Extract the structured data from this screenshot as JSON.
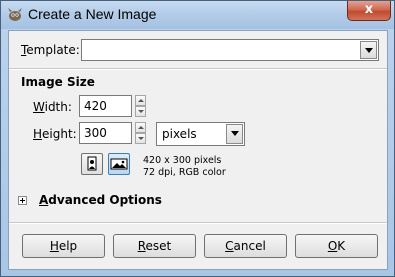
{
  "window": {
    "title": "Create a New Image",
    "close_glyph": "x"
  },
  "template": {
    "label_u": "T",
    "label_rest": "emplate:",
    "value": ""
  },
  "image_size": {
    "heading": "Image Size",
    "width_label_u": "W",
    "width_label_rest": "idth:",
    "width_value": "420",
    "height_label_u": "H",
    "height_label_rest": "eight:",
    "height_value": "300",
    "unit": "pixels",
    "orientation_selected": "landscape",
    "info_line1": "420 x 300 pixels",
    "info_line2": "72 dpi, RGB color"
  },
  "advanced": {
    "label_u": "A",
    "label_rest": "dvanced Options",
    "expanded": false
  },
  "buttons": {
    "help_u": "H",
    "help_rest": "elp",
    "reset_u": "R",
    "reset_rest": "eset",
    "cancel_u": "C",
    "cancel_rest": "ancel",
    "ok_u": "O",
    "ok_rest": "K"
  },
  "colors": {
    "accent": "#3c7fb1",
    "close_button": "#c04a2f"
  }
}
